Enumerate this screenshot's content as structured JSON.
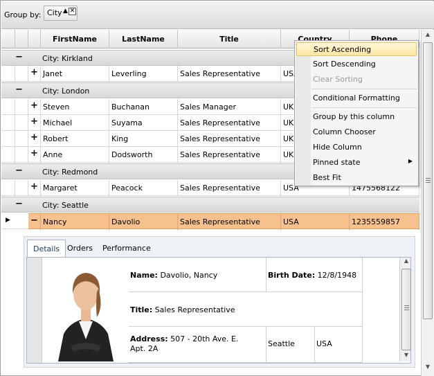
{
  "group_panel": {
    "label": "Group by:",
    "chip_text": "City",
    "chip_arrow": "▲",
    "chip_close": "✕"
  },
  "columns": [
    "FirstName",
    "LastName",
    "Title",
    "Country",
    "Phone"
  ],
  "groups": [
    {
      "header": "City: Kirkland",
      "toggle": "−",
      "rows": [
        {
          "first": "Janet",
          "last": "Leverling",
          "title": "Sales Representative",
          "country": "USA",
          "phone": ""
        }
      ]
    },
    {
      "header": "City: London",
      "toggle": "−",
      "rows": [
        {
          "first": "Steven",
          "last": "Buchanan",
          "title": "Sales Manager",
          "country": "UK",
          "phone": ""
        },
        {
          "first": "Michael",
          "last": "Suyama",
          "title": "Sales Representative",
          "country": "UK",
          "phone": ""
        },
        {
          "first": "Robert",
          "last": "King",
          "title": "Sales Representative",
          "country": "UK",
          "phone": ""
        },
        {
          "first": "Anne",
          "last": "Dodsworth",
          "title": "Sales Representative",
          "country": "UK",
          "phone": ""
        }
      ]
    },
    {
      "header": "City: Redmond",
      "toggle": "−",
      "rows": [
        {
          "first": "Margaret",
          "last": "Peacock",
          "title": "Sales Representative",
          "country": "USA",
          "phone": "1475568122"
        }
      ]
    },
    {
      "header": "City: Seattle",
      "toggle": "−",
      "rows": [
        {
          "first": "Nancy",
          "last": "Davolio",
          "title": "Sales Representative",
          "country": "USA",
          "phone": "1235559857",
          "selected": true
        }
      ]
    }
  ],
  "expander_plus": "+",
  "expander_minus": "−",
  "row_indicator": "▶",
  "details": {
    "tabs": [
      "Details",
      "Orders",
      "Performance"
    ],
    "name_label": "Name:",
    "name_value": "Davolio, Nancy",
    "birth_label": "Birth Date:",
    "birth_value": "12/8/1948",
    "title_label": "Title:",
    "title_value": "Sales Representative",
    "address_label": "Address:",
    "address_line1": "507 - 20th Ave. E.",
    "address_line2": "Apt. 2A",
    "city": "Seattle",
    "country": "USA"
  },
  "context_menu": {
    "items": [
      {
        "label": "Sort Ascending",
        "state": "highlighted"
      },
      {
        "label": "Sort Descending",
        "state": "normal"
      },
      {
        "label": "Clear Sorting",
        "state": "disabled"
      },
      {
        "label": "Conditional Formatting",
        "state": "normal"
      },
      {
        "label": "Group by this column",
        "state": "normal"
      },
      {
        "label": "Column Chooser",
        "state": "normal"
      },
      {
        "label": "Hide Column",
        "state": "normal"
      },
      {
        "label": "Pinned state",
        "state": "normal",
        "submenu": true
      },
      {
        "label": "Best Fit",
        "state": "normal"
      }
    ],
    "submenu_arrow": "▶"
  },
  "colors": {
    "selected_row": "#f7c08f",
    "menu_highlight": "#fde6a3"
  }
}
